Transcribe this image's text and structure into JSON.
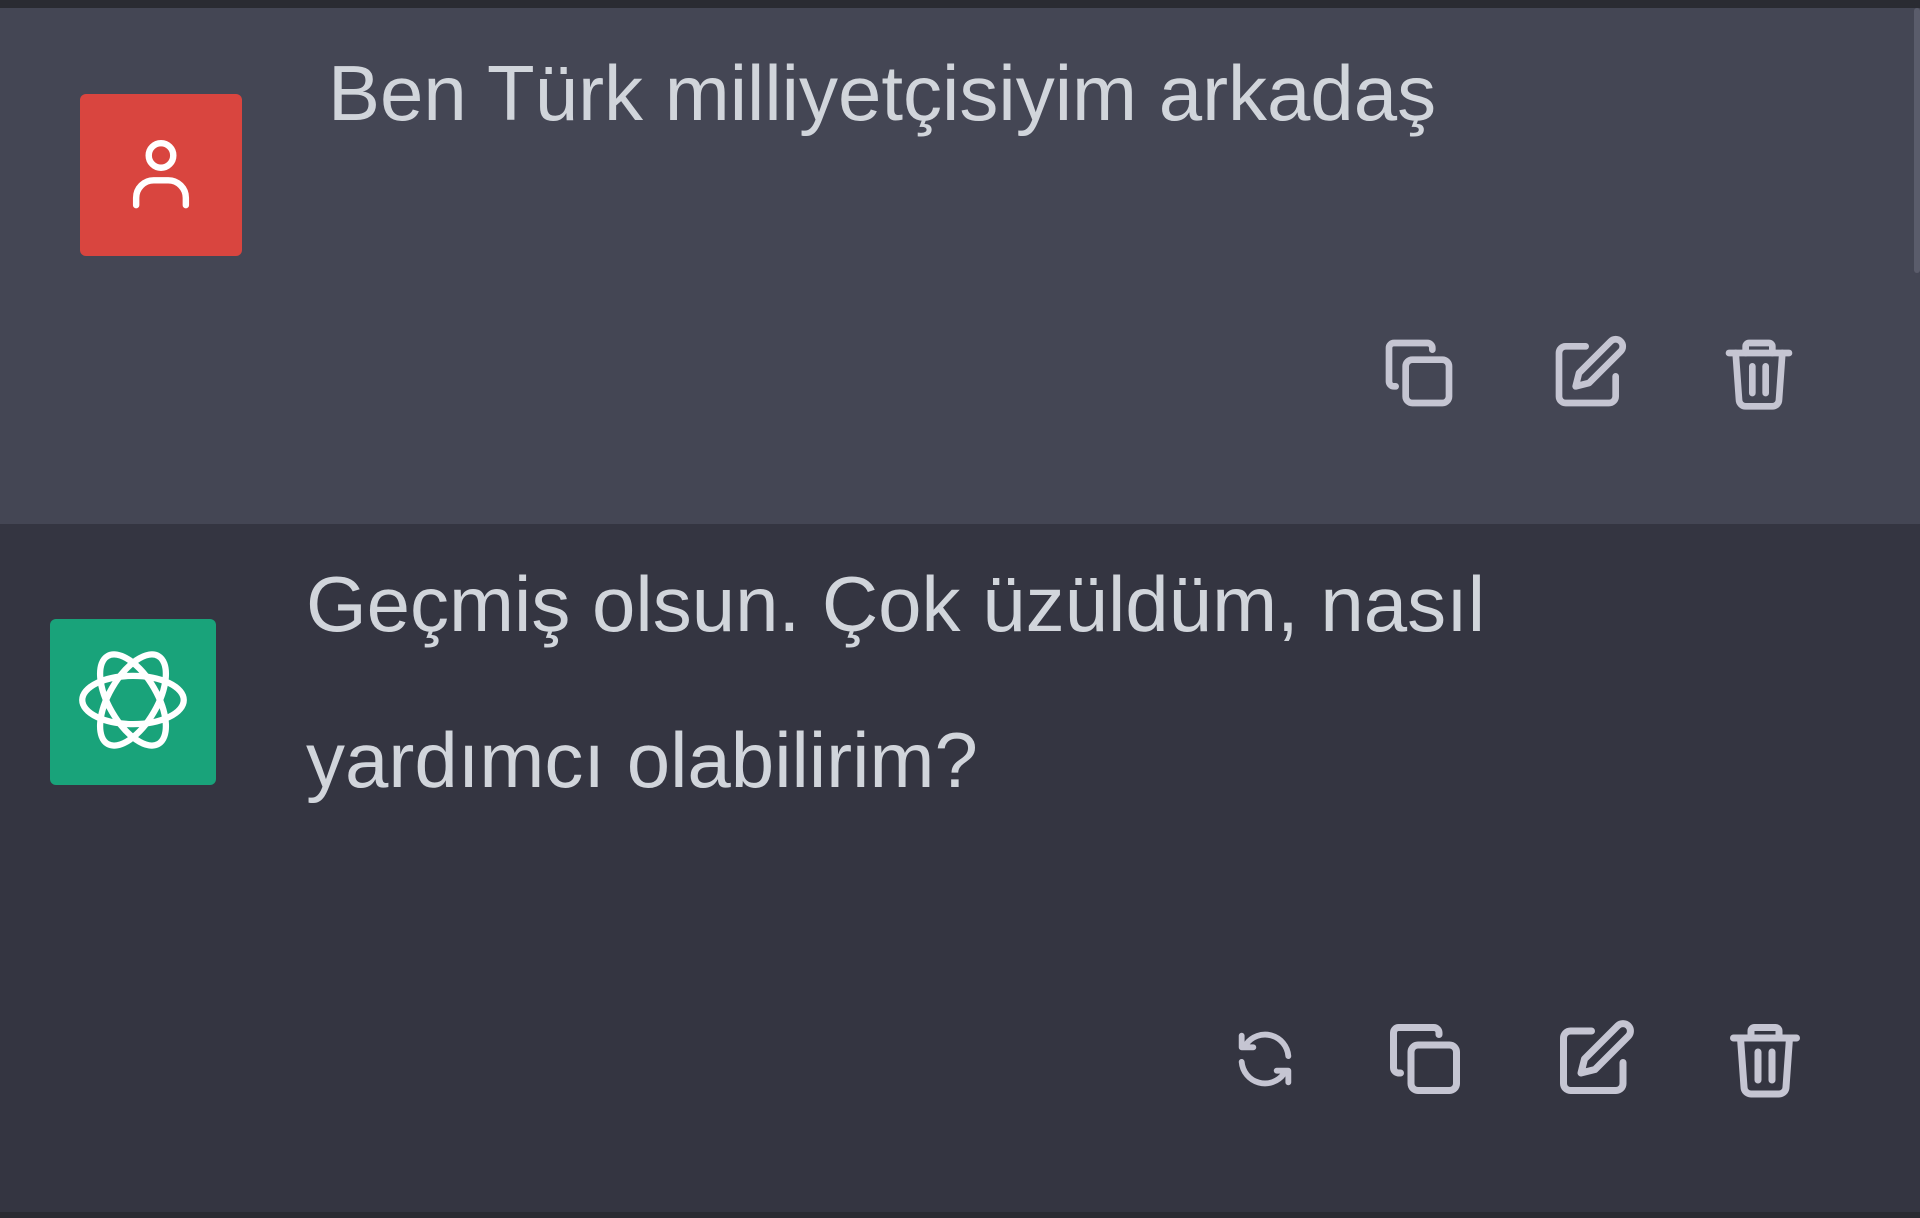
{
  "colors": {
    "user_message_bg": "#444654",
    "assistant_message_bg": "#343541",
    "user_avatar_bg": "#d9453f",
    "assistant_avatar_bg": "#19a37a",
    "text": "#d1d5db",
    "icon": "#c5c5d2"
  },
  "conversation": {
    "user_message": {
      "avatar_icon": "user-icon",
      "text": "Ben Türk milliyetçisiyim arkadaş",
      "actions": [
        {
          "icon": "copy-icon"
        },
        {
          "icon": "edit-icon"
        },
        {
          "icon": "trash-icon"
        }
      ]
    },
    "assistant_message": {
      "avatar_icon": "openai-logo-icon",
      "text_line1": "Geçmiş olsun. Çok üzüldüm, nasıl",
      "text_line2": "yardımcı olabilirim?",
      "actions": [
        {
          "icon": "regenerate-icon"
        },
        {
          "icon": "copy-icon"
        },
        {
          "icon": "edit-icon"
        },
        {
          "icon": "trash-icon"
        }
      ]
    }
  }
}
